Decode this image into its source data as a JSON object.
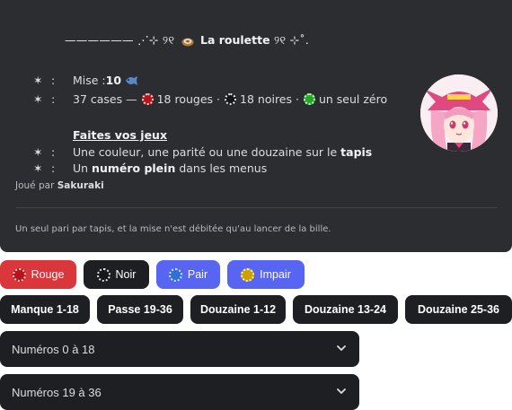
{
  "embed": {
    "title_deco_left": "——————  ⋰⊹ ୨୧",
    "title_text": "La roulette",
    "title_deco_right": "୨୧ ⊹˚.",
    "rows": {
      "bet_label": "Mise : ",
      "bet_value": "10",
      "cases_label": "37 cases —",
      "red_text": "18 rouges ·",
      "black_text": "18 noires ·",
      "green_text": "un seul zéro",
      "bullet": "✶",
      "colon": ":"
    },
    "heading": "Faites vos jeux",
    "line1_a": "Une couleur, une parité ou une douzaine sur le ",
    "line1_b": "tapis",
    "line2_a": "Un ",
    "line2_b": "numéro plein",
    "line2_c": " dans les menus",
    "played_prefix": "Joué par ",
    "played_user": "Sakuraki",
    "footer": "Un seul pari par tapis, et la mise n'est débitée qu'au lancer de la bille."
  },
  "buttons_row1": {
    "rouge": "Rouge",
    "noir": "Noir",
    "pair": "Pair",
    "impair": "Impair"
  },
  "buttons_row2": {
    "manque": "Manque 1-18",
    "passe": "Passe 19-36",
    "douzaine1": "Douzaine 1-12",
    "douzaine2": "Douzaine 13-24",
    "douzaine3": "Douzaine 25-36"
  },
  "selects": {
    "first": "Numéros 0 à 18",
    "second": "Numéros 19 à 36"
  },
  "colors": {
    "embed_bg": "#2b2d31",
    "red_button": "#da373c",
    "blurple": "#5865f2",
    "dark_button": "#1e1f22"
  }
}
